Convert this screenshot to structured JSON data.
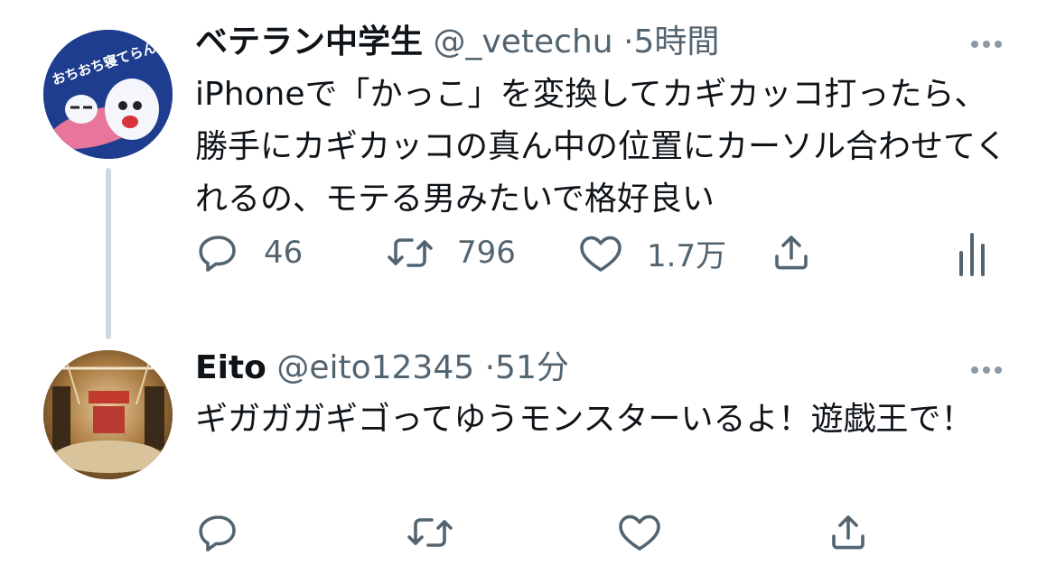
{
  "tweets": [
    {
      "display_name": "ベテラン中学生",
      "handle": "@_vetechu",
      "separator": "·",
      "time": "5時間",
      "avatar_text": "おちおち寝てらんない!",
      "text": "iPhoneで「かっこ」を変換してカギカッコ打ったら、勝手にカギカッコの真ん中の位置にカーソル合わせてくれるの、モテる男みたいで格好良い",
      "reply_count": "46",
      "retweet_count": "796",
      "like_count": "1.7万"
    },
    {
      "display_name": "Eito",
      "handle": "@eito12345",
      "separator": "·",
      "time": "51分",
      "text": "ギガガガギゴってゆうモンスターいるよ！遊戯王で！",
      "reply_count": "",
      "retweet_count": "",
      "like_count": ""
    }
  ],
  "icons": {
    "reply": "reply-bubble-icon",
    "retweet": "retweet-icon",
    "like": "heart-icon",
    "share": "share-upload-icon",
    "analytics": "analytics-bars-icon",
    "more": "more-dots-icon"
  },
  "colors": {
    "text_primary": "#0f1419",
    "text_secondary": "#536471",
    "thread_line": "#cfd9de"
  }
}
